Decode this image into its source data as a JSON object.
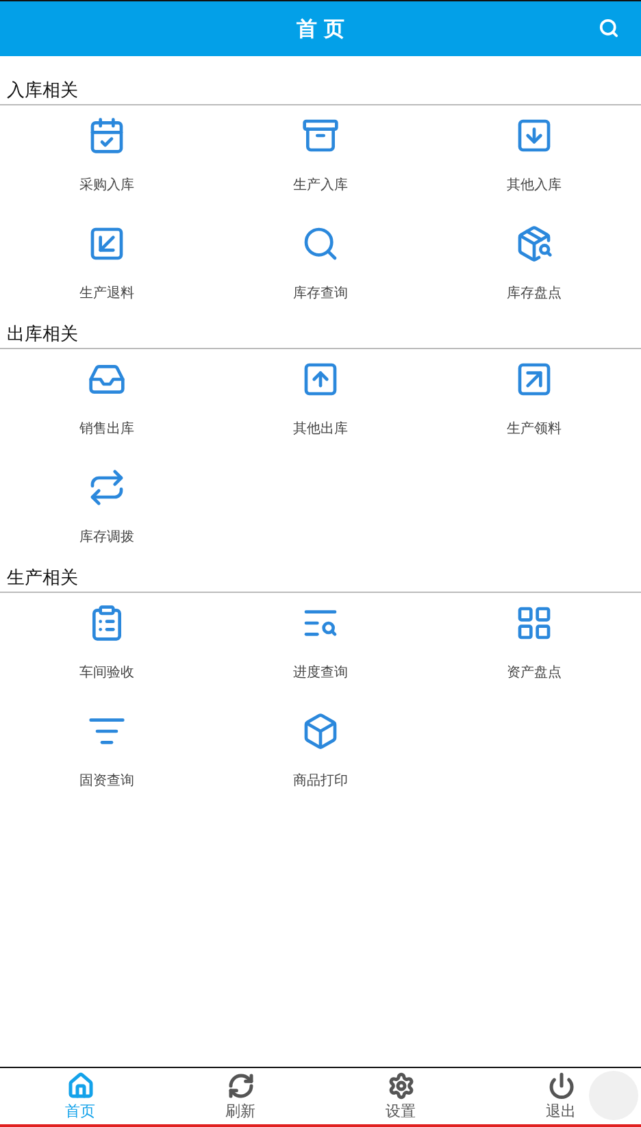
{
  "header": {
    "title": "首 页"
  },
  "sections": [
    {
      "title": "入库相关",
      "items": [
        {
          "label": "采购入库"
        },
        {
          "label": "生产入库"
        },
        {
          "label": "其他入库"
        },
        {
          "label": "生产退料"
        },
        {
          "label": "库存查询"
        },
        {
          "label": "库存盘点"
        }
      ]
    },
    {
      "title": "出库相关",
      "items": [
        {
          "label": "销售出库"
        },
        {
          "label": "其他出库"
        },
        {
          "label": "生产领料"
        },
        {
          "label": "库存调拨"
        }
      ]
    },
    {
      "title": "生产相关",
      "items": [
        {
          "label": "车间验收"
        },
        {
          "label": "进度查询"
        },
        {
          "label": "资产盘点"
        },
        {
          "label": "固资查询"
        },
        {
          "label": "商品打印"
        }
      ]
    }
  ],
  "tabs": [
    {
      "label": "首页",
      "selected": true
    },
    {
      "label": "刷新",
      "selected": false
    },
    {
      "label": "设置",
      "selected": false
    },
    {
      "label": "退出",
      "selected": false
    }
  ]
}
